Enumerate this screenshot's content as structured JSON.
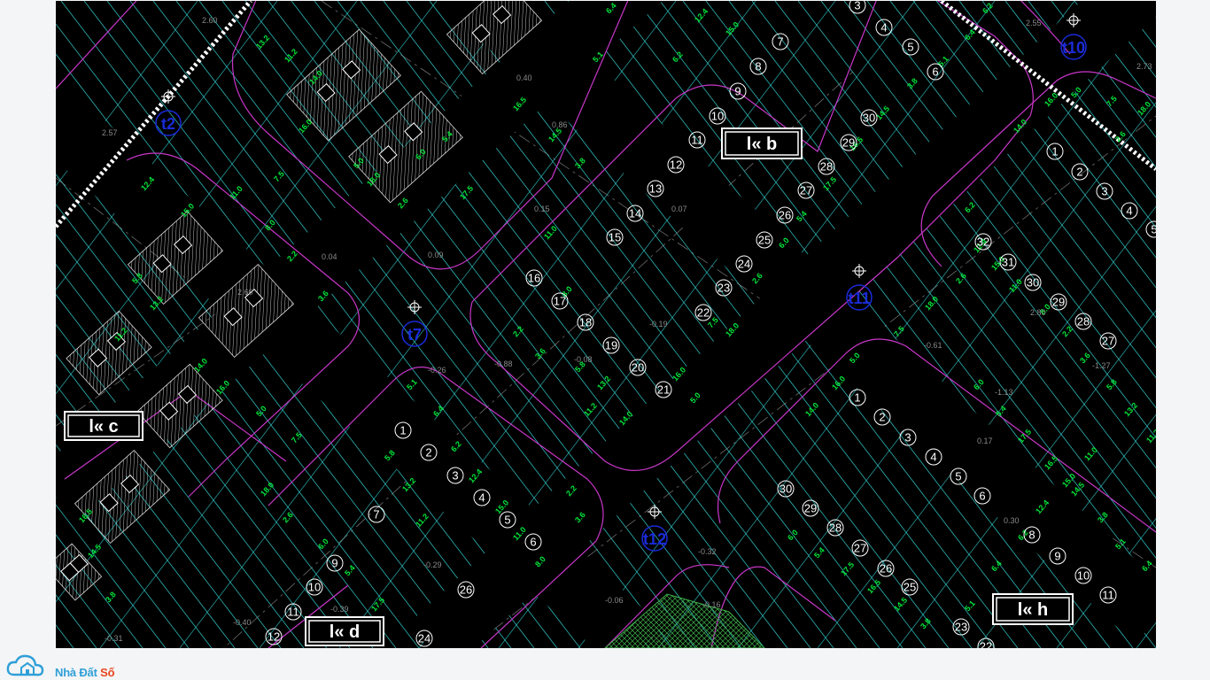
{
  "window": {
    "title": ""
  },
  "colors": {
    "background": "#000000",
    "road_boundary": "#c837c8",
    "lot_line": "#35d6d6",
    "dimension_text": "#00e639",
    "lot_number": "#ffffff",
    "survey_point": "#1a2bd9",
    "frame": "#f4f5f6",
    "hatch": "#bfbfbf",
    "brand_blue": "#2f9fd8",
    "brand_orange": "#e8451f"
  },
  "block_labels": [
    {
      "id": "b",
      "text": "l« b"
    },
    {
      "id": "c",
      "text": "l« c"
    },
    {
      "id": "d",
      "text": "l« d"
    },
    {
      "id": "h",
      "text": "l« h"
    }
  ],
  "survey_points": [
    {
      "id": "t2",
      "label": "t2"
    },
    {
      "id": "t7",
      "label": "t7"
    },
    {
      "id": "t10",
      "label": "t10"
    },
    {
      "id": "t11",
      "label": "t11"
    },
    {
      "id": "t12",
      "label": "t12"
    }
  ],
  "lot_groups": {
    "block_b_top": [
      "3",
      "4",
      "5",
      "6",
      "7",
      "8",
      "9",
      "10",
      "11",
      "12",
      "13",
      "14",
      "15",
      "16",
      "17",
      "18",
      "19",
      "20",
      "21"
    ],
    "block_b_right": [
      "30",
      "29",
      "28",
      "27",
      "26",
      "25",
      "24",
      "23",
      "22"
    ],
    "block_right_top": [
      "1",
      "2",
      "3",
      "4",
      "5",
      "32",
      "31",
      "30",
      "29",
      "28",
      "27"
    ],
    "block_h": [
      "1",
      "2",
      "3",
      "4",
      "5",
      "6",
      "8",
      "9",
      "10",
      "11",
      "30",
      "29",
      "28",
      "27",
      "26",
      "25",
      "23",
      "22"
    ],
    "block_d": [
      "1",
      "2",
      "3",
      "4",
      "5",
      "6",
      "7",
      "9",
      "10",
      "11",
      "12",
      "24",
      "26"
    ]
  },
  "dimension_labels": [
    "13.2",
    "11.2",
    "14.0",
    "16.0",
    "5.0",
    "7.5",
    "18.0",
    "2.6",
    "6.0",
    "5.4",
    "17.5",
    "16.5",
    "14.5",
    "3.8",
    "5.1",
    "6.4",
    "6.2",
    "12.4",
    "15.0",
    "11.0",
    "8.0",
    "2.2",
    "3.6",
    "5.8"
  ],
  "elevation_labels": [
    "2.60",
    "2.57",
    "0.40",
    "0.86",
    "0.15",
    "0.07",
    "0.04",
    "0.09",
    "-0.26",
    "-0.88",
    "-0.19",
    "-0.08",
    "-0.29",
    "-0.39",
    "-0.31",
    "-0.40",
    "-0.06",
    "-0.16",
    "-0.32",
    "-0.61",
    "-1.27",
    "-1.13",
    "0.17",
    "0.30",
    "2.80",
    "2.73",
    "2.55"
  ],
  "watermark": {
    "brand_main": "Nhà Đất ",
    "brand_accent": "Số"
  }
}
